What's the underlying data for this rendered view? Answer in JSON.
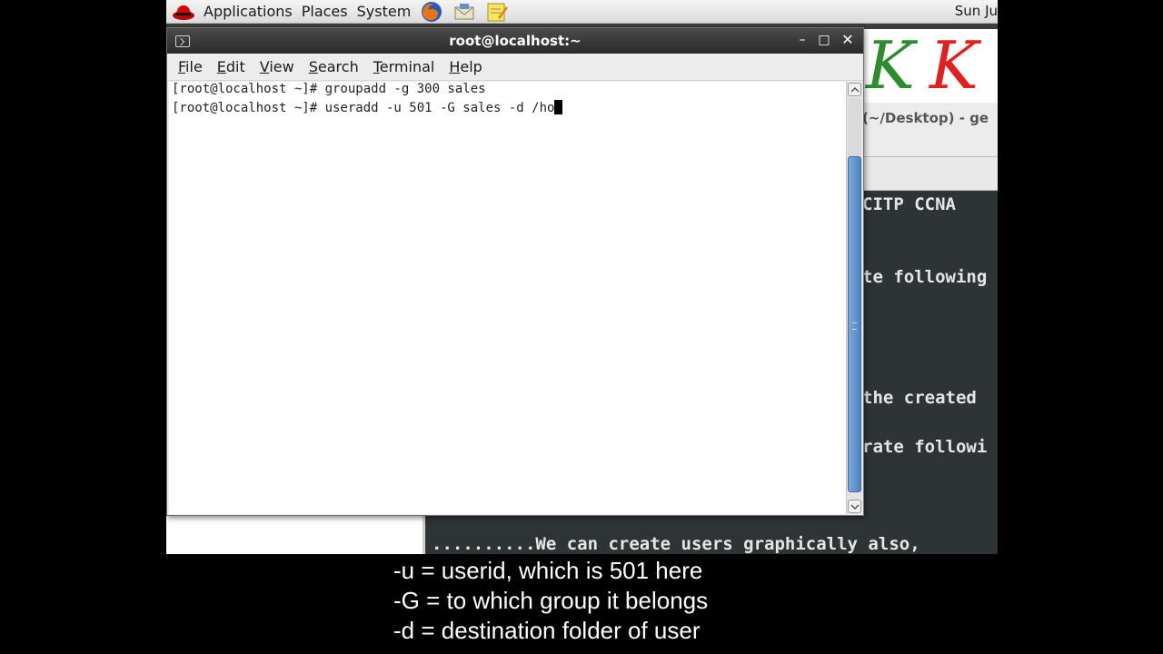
{
  "panel": {
    "menus": [
      "Applications",
      "Places",
      "System"
    ],
    "clock": "Sun Ju"
  },
  "background": {
    "logo_letters": [
      "K",
      "K"
    ],
    "gedit_title": "(~/Desktop) - ge",
    "gedit_lines": [
      "CITP CCNA",
      "te following",
      "the created",
      "rate followi"
    ],
    "bottom_line": "..........We can create users graphically also,"
  },
  "terminal": {
    "title": "root@localhost:~",
    "menu": [
      "File",
      "Edit",
      "View",
      "Search",
      "Terminal",
      "Help"
    ],
    "lines": [
      "[root@localhost ~]# groupadd -g 300 sales",
      "[root@localhost ~]# useradd -u 501 -G sales -d /ho"
    ]
  },
  "captions": [
    "-u = userid, which is 501 here",
    "-G = to which group it belongs",
    "-d = destination folder of user"
  ],
  "colors": {
    "titlebar": "#3a3a3a",
    "scroll_thumb": "#5f92cf",
    "editor_bg": "#2e3436",
    "logo_green": "#2e8b2e",
    "logo_red": "#dd2222"
  }
}
